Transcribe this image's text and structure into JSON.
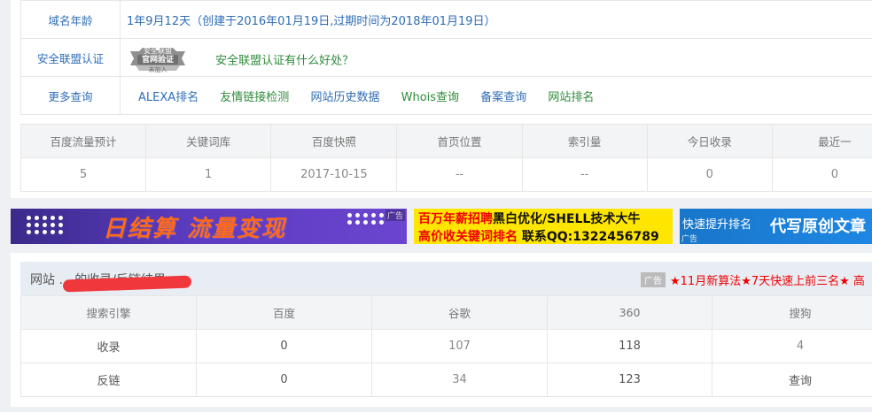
{
  "domain_age": {
    "label": "域名年龄",
    "value": "1年9月12天（创建于2016年01月19日,过期时间为2018年01月19日）"
  },
  "security": {
    "label": "安全联盟认证",
    "badge_top": "安全联盟",
    "badge_mid": "官网验证",
    "badge_bottom": "未加入",
    "link": "安全联盟认证有什么好处？"
  },
  "more": {
    "label": "更多查询",
    "links": [
      "ALEXA排名",
      "友情链接检测",
      "网站历史数据",
      "Whois查询",
      "备案查询",
      "网站排名"
    ]
  },
  "stats": {
    "headers": [
      "百度流量预计",
      "关键词库",
      "百度快照",
      "首页位置",
      "索引量",
      "今日收录",
      "最近一"
    ],
    "values": [
      "5",
      "1",
      "2017-10-15",
      "--",
      "--",
      "0",
      "0"
    ]
  },
  "ads": {
    "ad1_text": "日结算 流量变现",
    "ad_tag": "广告",
    "ad2_line1_a": "百万年薪招聘",
    "ad2_line1_b": "黑白优化/SHELL技术大牛",
    "ad2_line2_a": "高价收关键词排名",
    "ad2_line2_b": " 联系QQ:1322456789",
    "ad3_small": "快速提升排名",
    "ad3_big": "代写原创文章",
    "ad3_tag": "广告"
  },
  "results": {
    "title": "网站 ... 的收录/反链结果",
    "ad_tag": "广告",
    "promo": "★11月新算法★7天快速上前三名★   高",
    "headers": [
      "搜索引擎",
      "百度",
      "谷歌",
      "360",
      "搜狗"
    ],
    "rows": [
      {
        "name": "收录",
        "values": [
          "0",
          "107",
          "118",
          "4"
        ]
      },
      {
        "name": "反链",
        "values": [
          "0",
          "34",
          "123",
          "查询"
        ]
      }
    ]
  },
  "colors": {
    "link_blue": "#2f6db5",
    "link_green": "#2e8b3a",
    "alert_red": "#e23b3b"
  }
}
